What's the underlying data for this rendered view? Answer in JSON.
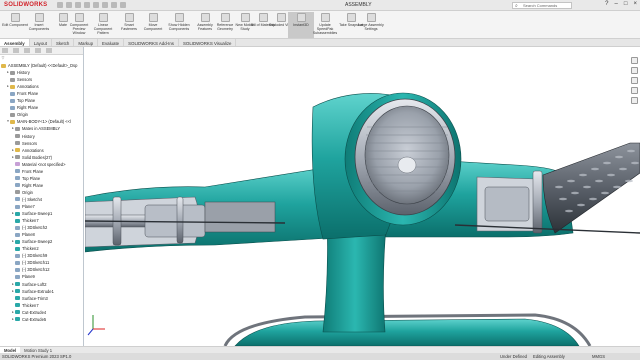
{
  "titlebar": {
    "logo": "SOLIDWORKS",
    "doc_title": "ASSEMBLY",
    "search_placeholder": "Search Commands"
  },
  "ribbon": {
    "buttons": [
      {
        "label": "Edit Component"
      },
      {
        "label": "Insert Components"
      },
      {
        "label": "Mate"
      },
      {
        "label": "Component Preview Window"
      },
      {
        "label": "Linear Component Pattern"
      },
      {
        "label": "Smart Fasteners"
      },
      {
        "label": "Move Component"
      },
      {
        "label": "Show Hidden Components"
      },
      {
        "label": "Assembly Features"
      },
      {
        "label": "Reference Geometry"
      },
      {
        "label": "New Motion Study"
      },
      {
        "label": "Bill of Materials"
      },
      {
        "label": "Exploded View"
      },
      {
        "label": "Instant3D"
      },
      {
        "label": "Update SpeedPak Subassemblies"
      },
      {
        "label": "Take Snapshot"
      },
      {
        "label": "Large Assembly Settings"
      }
    ]
  },
  "tabs": [
    "Assembly",
    "Layout",
    "Sketch",
    "Markup",
    "Evaluate",
    "SOLIDWORKS Add-Ins",
    "SOLIDWORKS Visualize"
  ],
  "tree": {
    "root": "ASSEMBLY (Default) <<Default>_Dsp",
    "items": [
      {
        "label": "History",
        "lvl": 1,
        "icon": "g",
        "exp": "▸"
      },
      {
        "label": "Sensors",
        "lvl": 1,
        "icon": "g",
        "exp": ""
      },
      {
        "label": "Annotations",
        "lvl": 1,
        "icon": "y",
        "exp": "▸"
      },
      {
        "label": "Front Plane",
        "lvl": 1,
        "icon": "b",
        "exp": ""
      },
      {
        "label": "Top Plane",
        "lvl": 1,
        "icon": "b",
        "exp": ""
      },
      {
        "label": "Right Plane",
        "lvl": 1,
        "icon": "b",
        "exp": ""
      },
      {
        "label": "Origin",
        "lvl": 1,
        "icon": "g",
        "exp": ""
      },
      {
        "label": "MAIN-BODY<1> (Default) <<l",
        "lvl": 1,
        "icon": "y",
        "exp": "▾"
      },
      {
        "label": "Mates in ASSEMBLY",
        "lvl": 2,
        "icon": "g",
        "exp": "▸"
      },
      {
        "label": "History",
        "lvl": 2,
        "icon": "g",
        "exp": ""
      },
      {
        "label": "Sensors",
        "lvl": 2,
        "icon": "g",
        "exp": ""
      },
      {
        "label": "Annotations",
        "lvl": 2,
        "icon": "y",
        "exp": "▸"
      },
      {
        "label": "Solid Bodies(27)",
        "lvl": 2,
        "icon": "g",
        "exp": "▸"
      },
      {
        "label": "Material <not specified>",
        "lvl": 2,
        "icon": "p",
        "exp": ""
      },
      {
        "label": "Front Plane",
        "lvl": 2,
        "icon": "b",
        "exp": ""
      },
      {
        "label": "Top Plane",
        "lvl": 2,
        "icon": "b",
        "exp": ""
      },
      {
        "label": "Right Plane",
        "lvl": 2,
        "icon": "b",
        "exp": ""
      },
      {
        "label": "Origin",
        "lvl": 2,
        "icon": "g",
        "exp": ""
      },
      {
        "label": "(-) Sketch4",
        "lvl": 2,
        "icon": "b",
        "exp": ""
      },
      {
        "label": "Plane7",
        "lvl": 2,
        "icon": "b",
        "exp": ""
      },
      {
        "label": "Surface-Sweep1",
        "lvl": 2,
        "icon": "c",
        "exp": "▸"
      },
      {
        "label": "Thicken7",
        "lvl": 2,
        "icon": "c",
        "exp": ""
      },
      {
        "label": "(-) 3DSketch2",
        "lvl": 2,
        "icon": "b",
        "exp": ""
      },
      {
        "label": "Plane8",
        "lvl": 2,
        "icon": "b",
        "exp": ""
      },
      {
        "label": "Surface-Sweep2",
        "lvl": 2,
        "icon": "c",
        "exp": "▸"
      },
      {
        "label": "Thicken2",
        "lvl": 2,
        "icon": "c",
        "exp": ""
      },
      {
        "label": "(-) 3DSketch9",
        "lvl": 2,
        "icon": "b",
        "exp": ""
      },
      {
        "label": "(-) 3DSketch11",
        "lvl": 2,
        "icon": "b",
        "exp": ""
      },
      {
        "label": "(-) 3DSketch12",
        "lvl": 2,
        "icon": "b",
        "exp": ""
      },
      {
        "label": "Plane9",
        "lvl": 2,
        "icon": "b",
        "exp": ""
      },
      {
        "label": "Surface-Loft2",
        "lvl": 2,
        "icon": "c",
        "exp": "▸"
      },
      {
        "label": "Surface-Extrude1",
        "lvl": 2,
        "icon": "c",
        "exp": "▸"
      },
      {
        "label": "Surface-Trim3",
        "lvl": 2,
        "icon": "c",
        "exp": ""
      },
      {
        "label": "Thicken7",
        "lvl": 2,
        "icon": "c",
        "exp": ""
      },
      {
        "label": "Cut-Extrude4",
        "lvl": 2,
        "icon": "c",
        "exp": "▸"
      },
      {
        "label": "Cut-Extrude5",
        "lvl": 2,
        "icon": "c",
        "exp": "▸"
      }
    ]
  },
  "bottom_tabs": [
    "Model",
    "Motion Study 1"
  ],
  "status": {
    "left": "SOLIDWORKS Premium 2023 SP1.0",
    "under": "Under Defined",
    "editing": "Editing Assembly",
    "units": "MMGS"
  },
  "colors": {
    "body_teal": "#1f9e99",
    "accent_red": "#d2232a"
  }
}
